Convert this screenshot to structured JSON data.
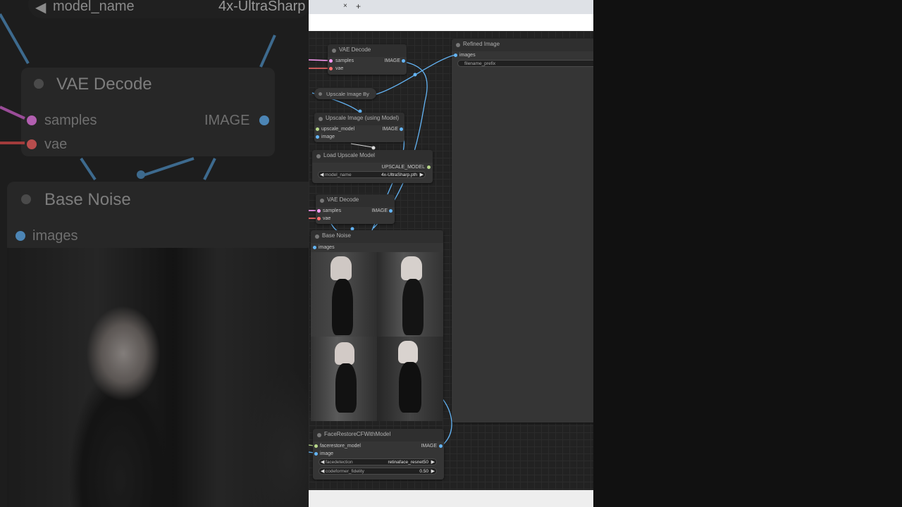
{
  "background_zoom": {
    "model_name_label": "model_name",
    "model_name_value": "4x-UltraSharp",
    "vae_decode_title": "VAE Decode",
    "samples_label": "samples",
    "image_output_label": "IMAGE",
    "vae_label": "vae",
    "base_noise_title": "Base Noise",
    "images_label": "images"
  },
  "browser": {
    "tab_close": "×",
    "new_tab": "+"
  },
  "nodes": {
    "vae_decode_1": {
      "title": "VAE Decode",
      "inputs": [
        "samples",
        "vae"
      ],
      "output": "IMAGE"
    },
    "upscale_image_by": {
      "title": "Upscale Image By"
    },
    "upscale_using_model": {
      "title": "Upscale Image (using Model)",
      "inputs": [
        "upscale_model",
        "image"
      ],
      "output": "IMAGE"
    },
    "load_upscale_model": {
      "title": "Load Upscale Model",
      "output": "UPSCALE_MODEL",
      "widget_label": "model_name",
      "widget_value": "4x-UltraSharp.pth"
    },
    "vae_decode_2": {
      "title": "VAE Decode",
      "inputs": [
        "samples",
        "vae"
      ],
      "output": "IMAGE"
    },
    "base_noise": {
      "title": "Base Noise",
      "input": "images"
    },
    "refined_image": {
      "title": "Refined Image",
      "input": "images",
      "widget_label": "filename_prefix"
    },
    "face_restore": {
      "title": "FaceRestoreCFWithModel",
      "inputs": [
        "facerestore_model",
        "image"
      ],
      "output": "IMAGE",
      "widgets": [
        {
          "label": "facedetection",
          "value": "retinaface_resnet50"
        },
        {
          "label": "codeformer_fidelity",
          "value": "0.50"
        }
      ]
    }
  },
  "colors": {
    "canvas": "#222222",
    "node": "#353535",
    "image_wire": "#64b5f6",
    "latent_wire": "#ff9cf9",
    "vae_wire": "#ff6e6e",
    "model_wire": "#b8d88a"
  },
  "arrows": {
    "left": "◀",
    "right": "▶"
  }
}
